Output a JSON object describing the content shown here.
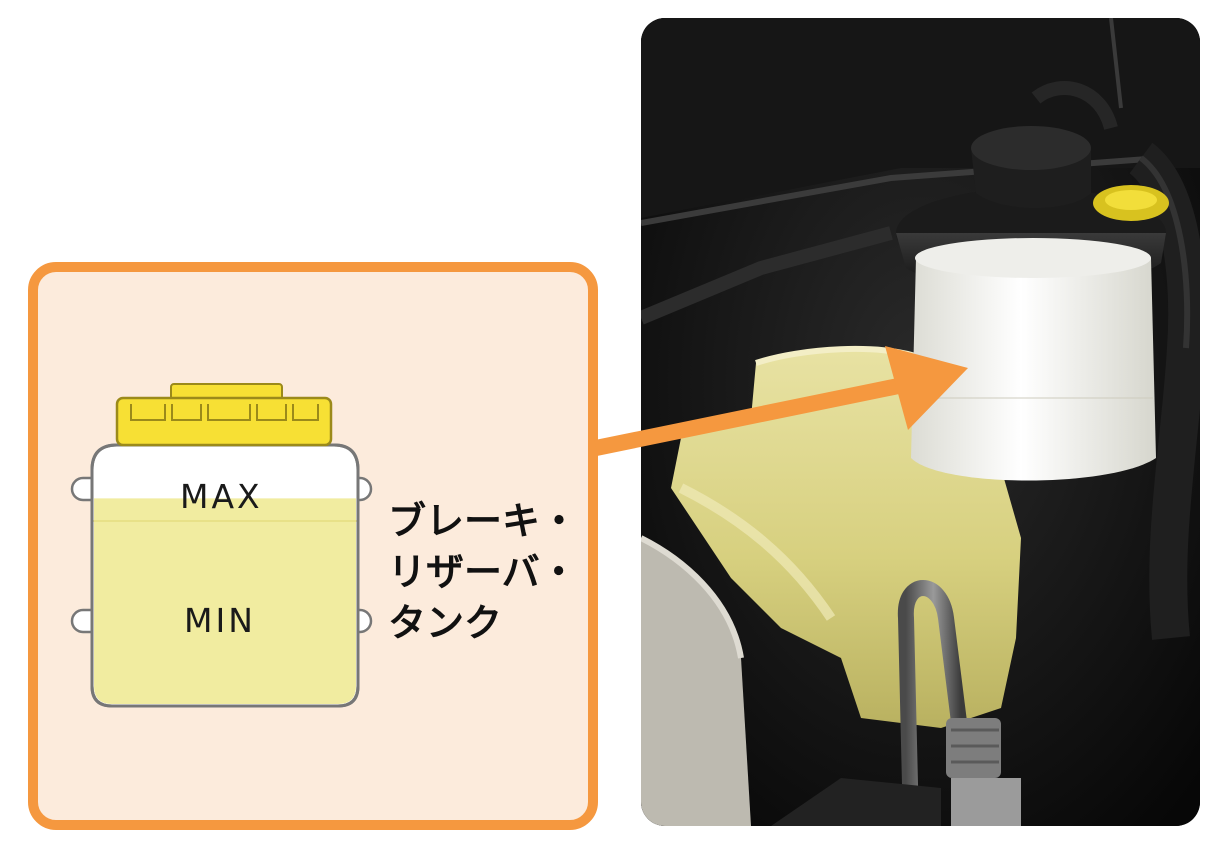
{
  "diagram": {
    "tank_marks": {
      "max": "MAX",
      "min": "MIN"
    },
    "part_label_lines": [
      "ブレーキ・",
      "リザーバ・",
      "タンク"
    ],
    "fluid_level_percent": 80,
    "colors": {
      "panel_border": "#f5983f",
      "panel_background": "#fcebdc",
      "arrow": "#f5983f",
      "cap": "#f7e034",
      "fluid": "#f1eca0"
    },
    "icons": [
      "reservoir-tank-icon",
      "tank-cap-icon",
      "callout-arrow-icon"
    ]
  }
}
